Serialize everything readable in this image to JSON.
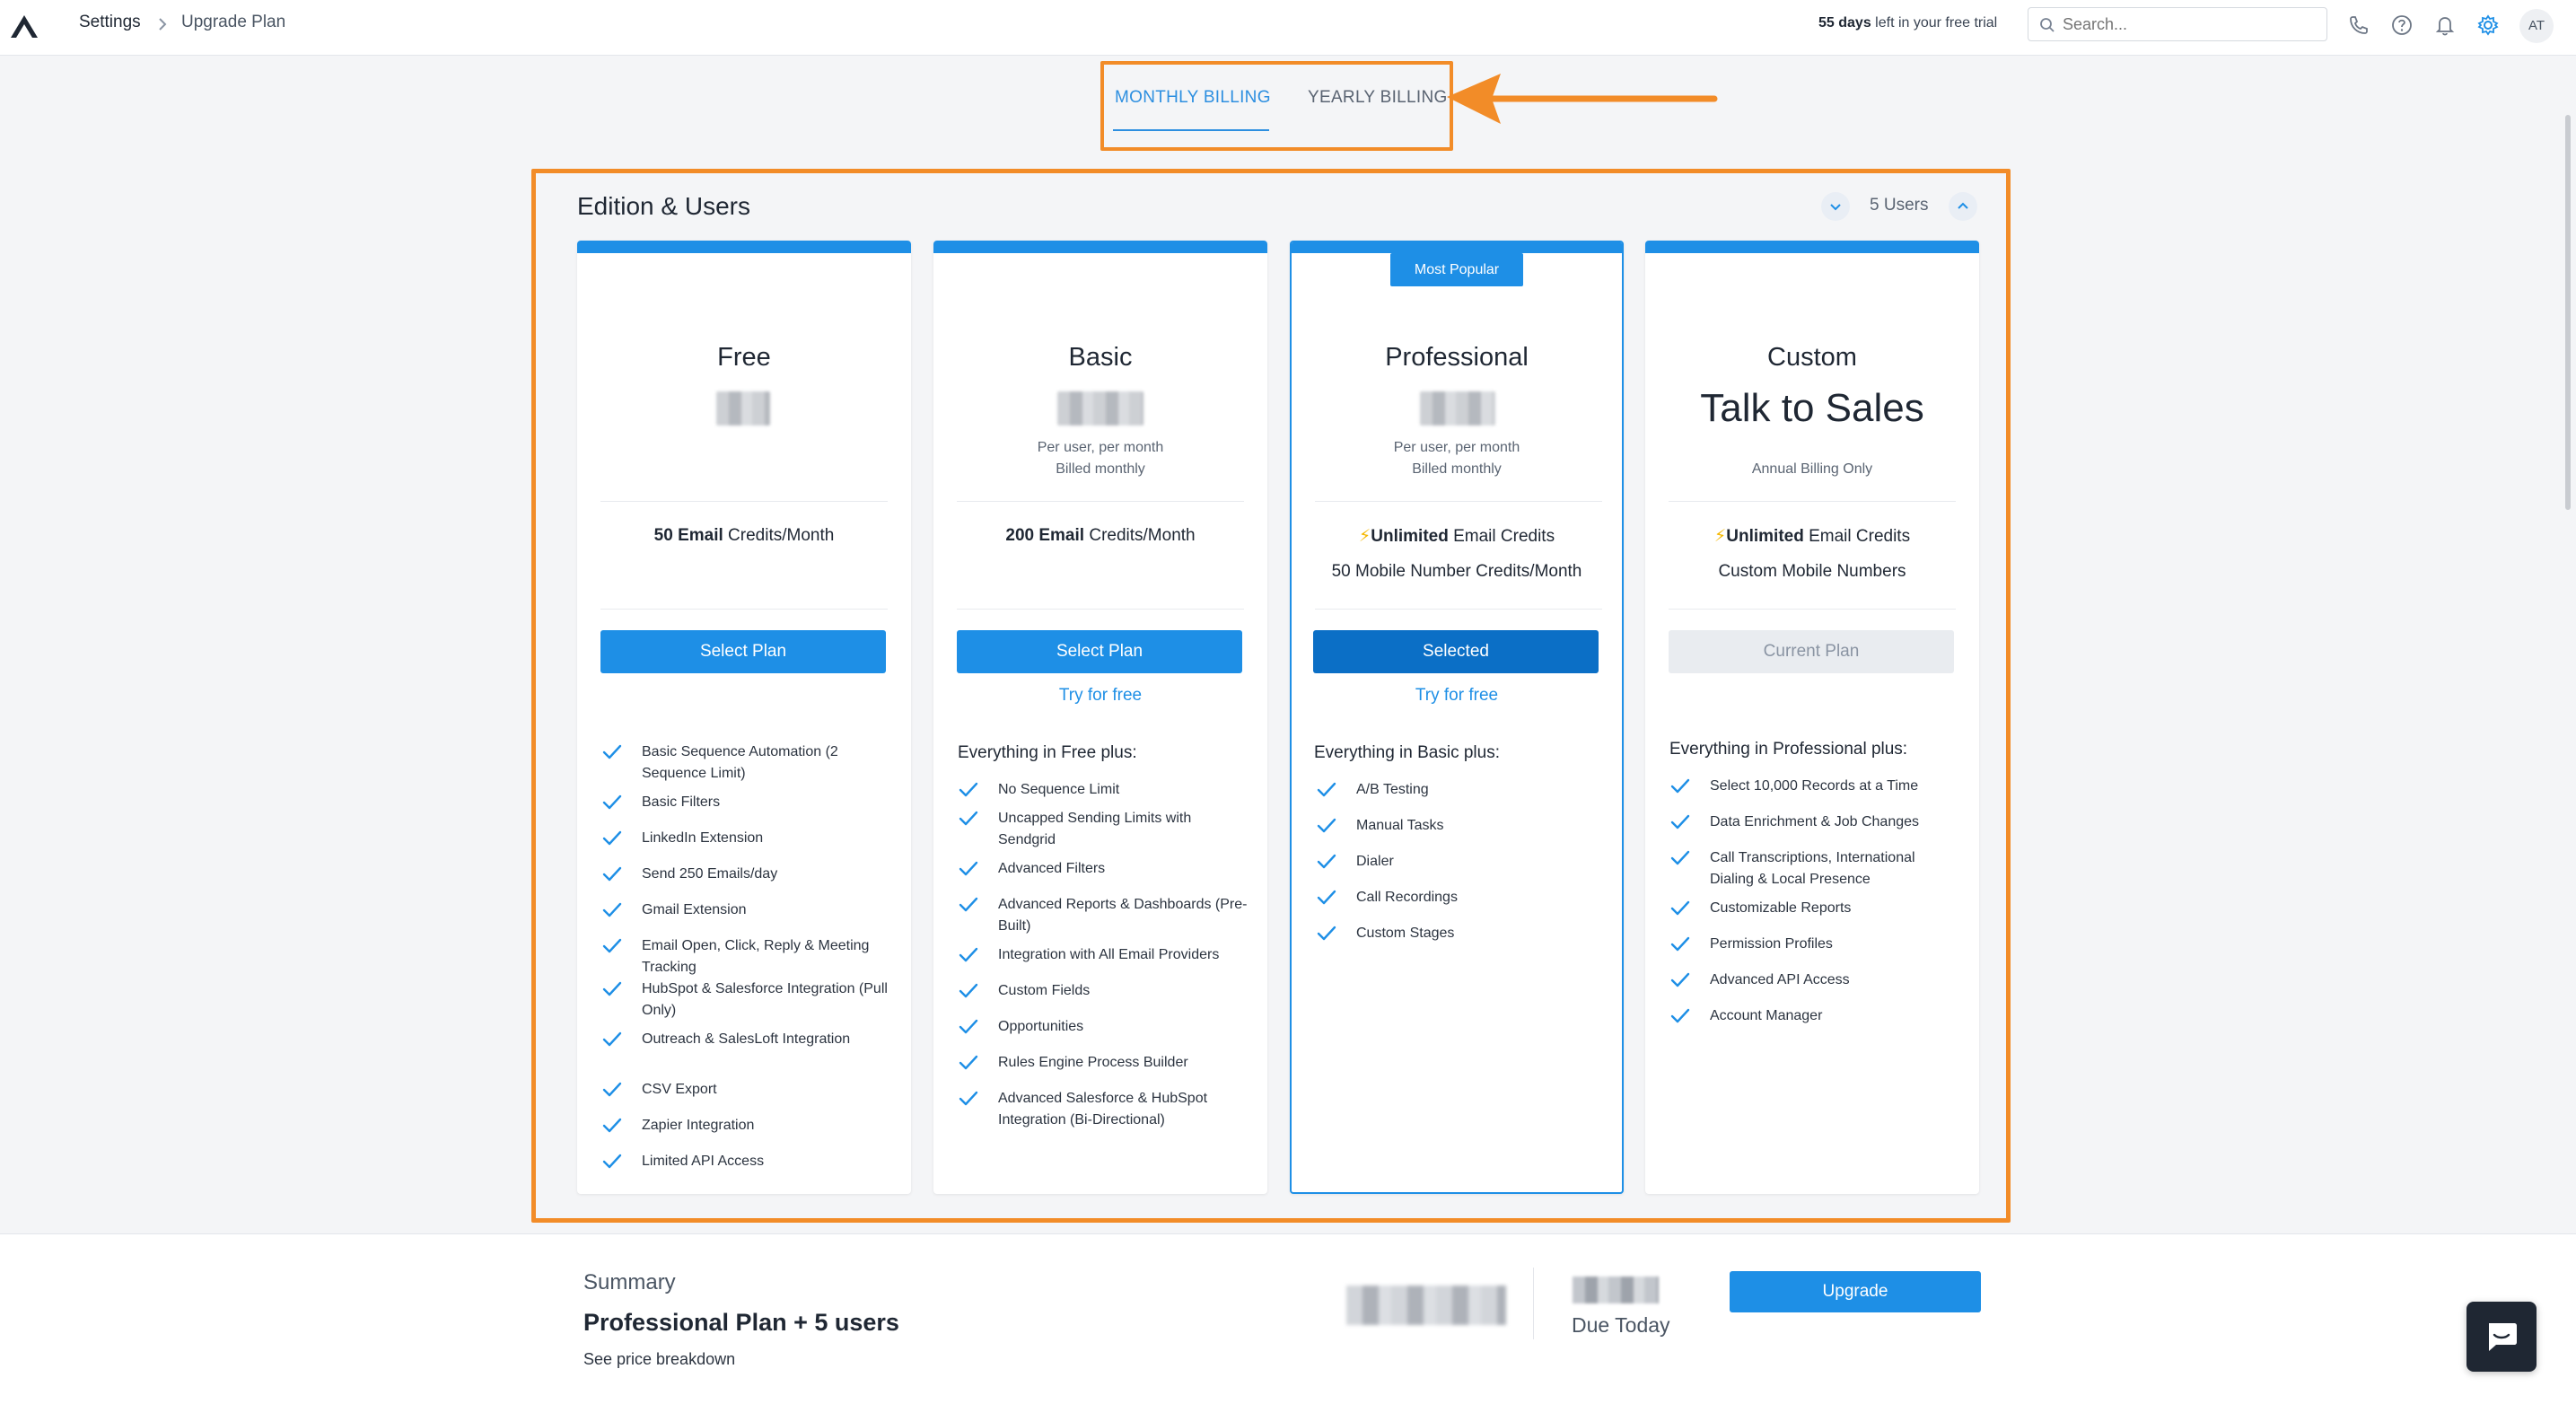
{
  "breadcrumb": {
    "root": "Settings",
    "current": "Upgrade Plan"
  },
  "header": {
    "trial_days": "55 days",
    "trial_suffix": " left in your free trial",
    "search_placeholder": "Search...",
    "avatar_initials": "AT",
    "icons": [
      "phone-icon",
      "help-icon",
      "bell-icon",
      "gear-icon"
    ]
  },
  "billing_tabs": [
    {
      "label": "MONTHLY BILLING",
      "active": true
    },
    {
      "label": "YEARLY BILLING",
      "active": false
    }
  ],
  "edition": {
    "title": "Edition & Users",
    "users_label": "5 Users"
  },
  "plans": [
    {
      "name": "Free",
      "credit_bold": "50 Email",
      "credit_rest": " Credits/Month",
      "button": "Select Plan",
      "features": [
        "Basic Sequence Automation (2 Sequence Limit)",
        "Basic Filters",
        "LinkedIn Extension",
        "Send 250 Emails/day",
        "Gmail Extension",
        "Email Open, Click, Reply & Meeting Tracking",
        "HubSpot & Salesforce Integration (Pull Only)",
        "Outreach & SalesLoft Integration",
        "CSV Export",
        "Zapier Integration",
        "Limited API Access"
      ]
    },
    {
      "name": "Basic",
      "price_note_1": "Per user, per month",
      "price_note_2": "Billed monthly",
      "credit_bold": "200 Email",
      "credit_rest": " Credits/Month",
      "button": "Select Plan",
      "try": "Try for free",
      "everything": "Everything in Free plus:",
      "features": [
        "No Sequence Limit",
        "Uncapped Sending Limits with Sendgrid",
        "Advanced Filters",
        "Advanced Reports & Dashboards (Pre-Built)",
        "Integration with All Email Providers",
        "Custom Fields",
        "Opportunities",
        "Rules Engine Process Builder",
        "Advanced Salesforce & HubSpot Integration (Bi-Directional)"
      ]
    },
    {
      "name": "Professional",
      "badge": "Most Popular",
      "price_note_1": "Per user, per month",
      "price_note_2": "Billed monthly",
      "credit_bold": "Unlimited",
      "credit_rest": " Email Credits",
      "credit_line2": "50 Mobile Number Credits/Month",
      "button": "Selected",
      "try": "Try for free",
      "everything": "Everything in Basic plus:",
      "features": [
        "A/B Testing",
        "Manual Tasks",
        "Dialer",
        "Call Recordings",
        "Custom Stages"
      ]
    },
    {
      "name": "Custom",
      "headline": "Talk to Sales",
      "price_note_2": "Annual Billing Only",
      "credit_bold": "Unlimited",
      "credit_rest": " Email Credits",
      "credit_line2": "Custom Mobile Numbers",
      "button": "Current Plan",
      "everything": "Everything in Professional plus:",
      "features": [
        "Select 10,000 Records at a Time",
        "Data Enrichment & Job Changes",
        "Call Transcriptions, International Dialing & Local Presence",
        "Customizable Reports",
        "Permission Profiles",
        "Advanced API Access",
        "Account Manager"
      ]
    }
  ],
  "summary": {
    "title": "Summary",
    "plan": "Professional Plan + 5 users",
    "breakdown_link": "See price breakdown",
    "due_label": "Due Today",
    "upgrade_button": "Upgrade"
  },
  "colors": {
    "accent": "#1e8fe6",
    "highlight": "#f28c28",
    "selected_button": "#0b6fc6"
  }
}
